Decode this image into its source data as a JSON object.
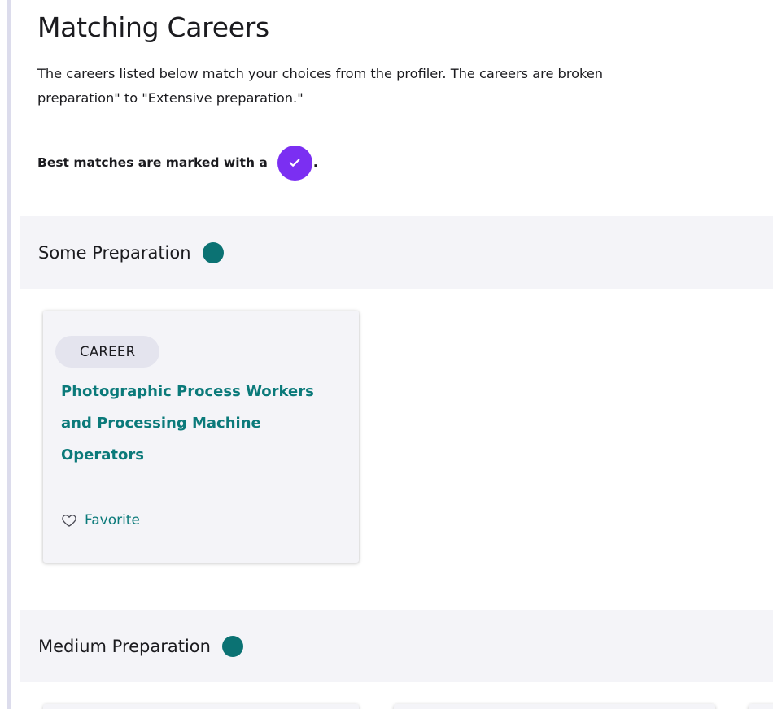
{
  "page": {
    "title": "Matching Careers",
    "intro_line1": "The careers listed below match your choices from the profiler. The careers are broken",
    "intro_line2": "preparation\" to \"Extensive preparation.\"",
    "best_matches_text": "Best matches are marked with a",
    "best_matches_period": "."
  },
  "sections": [
    {
      "title": "Some Preparation",
      "cards": [
        {
          "tag": "CAREER",
          "title_lines": [
            "Photographic Process Workers",
            "and Processing Machine",
            "Operators"
          ],
          "favorite_label": "Favorite"
        }
      ]
    },
    {
      "title": "Medium Preparation"
    }
  ],
  "colors": {
    "best_match_badge": "#7b2ff2",
    "preparation_dot": "#0b7273",
    "career_link": "#0b7a7a",
    "section_band": "#f4f4f8"
  },
  "icons": {
    "best_match": "check-icon",
    "favorite": "heart-outline-icon",
    "preparation_level": "filled-circle-icon"
  }
}
